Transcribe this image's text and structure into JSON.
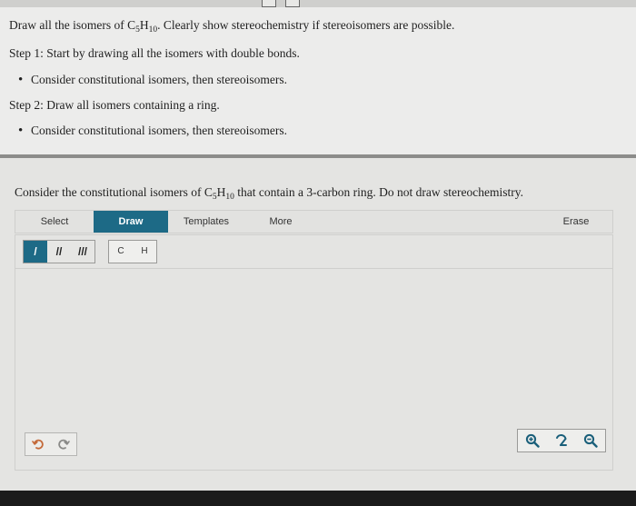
{
  "question": {
    "line1_pre": "Draw all the isomers of C",
    "line1_sub1": "5",
    "line1_mid": "H",
    "line1_sub2": "10",
    "line1_post": ". Clearly show stereochemistry if stereoisomers are possible.",
    "step1": "Step 1: Start by drawing all the isomers with double bonds.",
    "step1_bullet": "Consider constitutional isomers, then stereoisomers.",
    "step2": "Step 2: Draw all isomers containing a ring.",
    "step2_bullet": "Consider constitutional isomers, then stereoisomers."
  },
  "prompt": {
    "pre": "Consider the constitutional isomers of C",
    "sub1": "5",
    "mid": "H",
    "sub2": "10",
    "post": " that contain a 3-carbon ring. Do not draw stereochemistry."
  },
  "toolbar": {
    "select": "Select",
    "draw": "Draw",
    "templates": "Templates",
    "more": "More",
    "erase": "Erase"
  },
  "bonds": {
    "single": "/",
    "double": "//",
    "triple": "///"
  },
  "atoms": [
    "C",
    "H"
  ],
  "colors": {
    "accent": "#1d6a86",
    "zoom_icon": "#1a5f7a"
  },
  "icons": {
    "undo": "undo-icon",
    "redo": "redo-icon",
    "zoom_in": "zoom-in-icon",
    "reset": "reset-icon",
    "zoom_out": "zoom-out-icon"
  }
}
